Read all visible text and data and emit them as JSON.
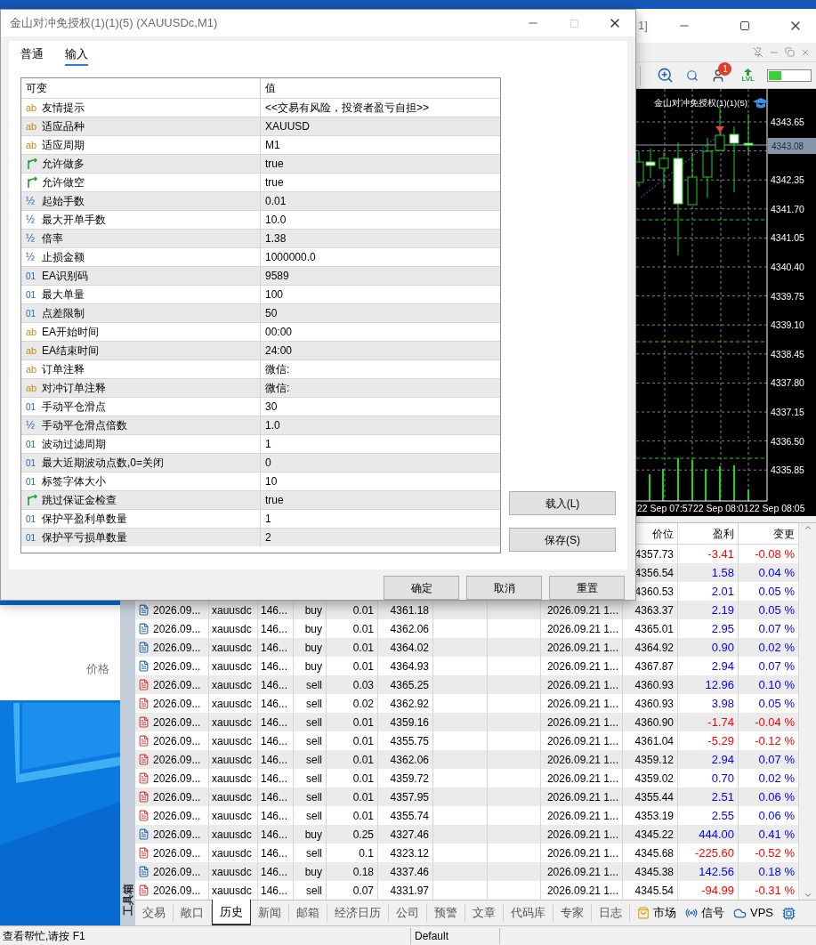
{
  "dialog": {
    "title": "金山对冲免授权(1)(1)(5) (XAUUSDc,M1)",
    "tabs": [
      {
        "label": "普通",
        "selected": false
      },
      {
        "label": "输入",
        "selected": true
      }
    ],
    "columns": [
      "可变",
      "值"
    ],
    "params": [
      {
        "kind": "string",
        "icon": "ab",
        "name": "友情提示",
        "value": "<<交易有风险，投资者盈亏自担>>"
      },
      {
        "kind": "string",
        "icon": "ab",
        "name": "适应品种",
        "value": "XAUUSD"
      },
      {
        "kind": "string",
        "icon": "ab",
        "name": "适应周期",
        "value": "M1"
      },
      {
        "kind": "bool",
        "name": "允许做多",
        "value": "true"
      },
      {
        "kind": "bool",
        "name": "允许做空",
        "value": "true"
      },
      {
        "kind": "double",
        "icon": "½",
        "name": "起始手数",
        "value": "0.01"
      },
      {
        "kind": "double",
        "icon": "½",
        "name": "最大开单手数",
        "value": "10.0"
      },
      {
        "kind": "double",
        "icon": "½",
        "name": "倍率",
        "value": "1.38"
      },
      {
        "kind": "double",
        "icon": "½",
        "name": "止损金额",
        "value": "1000000.0"
      },
      {
        "kind": "int",
        "icon": "01",
        "name": "EA识别码",
        "value": "9589"
      },
      {
        "kind": "int",
        "icon": "01",
        "name": "最大单量",
        "value": "100"
      },
      {
        "kind": "int",
        "icon": "01",
        "name": "点差限制",
        "value": "50"
      },
      {
        "kind": "string",
        "icon": "ab",
        "name": "EA开始时间",
        "value": "00:00"
      },
      {
        "kind": "string",
        "icon": "ab",
        "name": "EA结束时间",
        "value": "24:00"
      },
      {
        "kind": "string",
        "icon": "ab",
        "name": "订单注释",
        "value": "微信:"
      },
      {
        "kind": "string",
        "icon": "ab",
        "name": "对冲订单注释",
        "value": "微信:"
      },
      {
        "kind": "int",
        "icon": "01",
        "name": "手动平仓滑点",
        "value": "30"
      },
      {
        "kind": "double",
        "icon": "½",
        "name": "手动平仓滑点倍数",
        "value": "1.0"
      },
      {
        "kind": "int",
        "icon": "01",
        "name": "波动过滤周期",
        "value": "1"
      },
      {
        "kind": "int",
        "icon": "01",
        "name": "最大近期波动点数,0=关闭",
        "value": "0"
      },
      {
        "kind": "int",
        "icon": "01",
        "name": "标签字体大小",
        "value": "10"
      },
      {
        "kind": "bool",
        "name": "跳过保证金检查",
        "value": "true"
      },
      {
        "kind": "int",
        "icon": "01",
        "name": "保护平盈利单数量",
        "value": "1"
      },
      {
        "kind": "int",
        "icon": "01",
        "name": "保护平亏损单数量",
        "value": "2"
      }
    ],
    "side_buttons": [
      "载入(L)",
      "保存(S)"
    ],
    "buttons": [
      "确定",
      "取消",
      "重置"
    ]
  },
  "background_window": {
    "column": "价格"
  },
  "main_window": {
    "title": "1]",
    "toolbar": {
      "notification_count": "1",
      "lvl_label": "LVL",
      "level": 0.3
    },
    "chart": {
      "title": "金山对冲免授权(1)(1)(5)",
      "price_labels": [
        "4343.65",
        "4342.35",
        "4341.70",
        "4341.05",
        "4340.40",
        "4339.75",
        "4339.10",
        "4338.45",
        "4337.80",
        "4337.15",
        "4336.50",
        "4335.85"
      ],
      "current_price": "4343.08",
      "time_labels": [
        "22 Sep 07:57",
        "22 Sep 08:01",
        "22 Sep 08:05"
      ]
    },
    "table": {
      "columns": [
        "价位",
        "盈利",
        "变更"
      ],
      "rows": [
        {
          "close_price": "4357.73",
          "profit": "-3.41",
          "change": "-0.08 %",
          "color": "#ff0000"
        },
        {
          "close_price": "4356.54",
          "profit": "1.58",
          "change": "0.04 %",
          "color": "#0000ff"
        },
        {
          "close_price": "4360.53",
          "profit": "2.01",
          "change": "0.05 %",
          "color": "#0000ff"
        },
        {
          "kind": "buy",
          "time": "2026.09...",
          "symbol": "xauusdc",
          "ticket": "146...",
          "type": "buy",
          "size": "0.01",
          "price": "4361.18",
          "close_time": "2026.09.21 1...",
          "close_price": "4363.37",
          "profit": "2.19",
          "change": "0.05 %",
          "color": "#0000ff"
        },
        {
          "kind": "buy",
          "time": "2026.09...",
          "symbol": "xauusdc",
          "ticket": "146...",
          "type": "buy",
          "size": "0.01",
          "price": "4362.06",
          "close_time": "2026.09.21 1...",
          "close_price": "4365.01",
          "profit": "2.95",
          "change": "0.07 %",
          "color": "#0000ff"
        },
        {
          "kind": "buy",
          "time": "2026.09...",
          "symbol": "xauusdc",
          "ticket": "146...",
          "type": "buy",
          "size": "0.01",
          "price": "4364.02",
          "close_time": "2026.09.21 1...",
          "close_price": "4364.92",
          "profit": "0.90",
          "change": "0.02 %",
          "color": "#0000ff"
        },
        {
          "kind": "buy",
          "time": "2026.09...",
          "symbol": "xauusdc",
          "ticket": "146...",
          "type": "buy",
          "size": "0.01",
          "price": "4364.93",
          "close_time": "2026.09.21 1...",
          "close_price": "4367.87",
          "profit": "2.94",
          "change": "0.07 %",
          "color": "#0000ff"
        },
        {
          "kind": "sell",
          "time": "2026.09...",
          "symbol": "xauusdc",
          "ticket": "146...",
          "type": "sell",
          "size": "0.03",
          "price": "4365.25",
          "close_time": "2026.09.21 1...",
          "close_price": "4360.93",
          "profit": "12.96",
          "change": "0.10 %",
          "color": "#0000ff"
        },
        {
          "kind": "sell",
          "time": "2026.09...",
          "symbol": "xauusdc",
          "ticket": "146...",
          "type": "sell",
          "size": "0.02",
          "price": "4362.92",
          "close_time": "2026.09.21 1...",
          "close_price": "4360.93",
          "profit": "3.98",
          "change": "0.05 %",
          "color": "#0000ff"
        },
        {
          "kind": "sell",
          "time": "2026.09...",
          "symbol": "xauusdc",
          "ticket": "146...",
          "type": "sell",
          "size": "0.01",
          "price": "4359.16",
          "close_time": "2026.09.21 1...",
          "close_price": "4360.90",
          "profit": "-1.74",
          "change": "-0.04 %",
          "color": "#ff0000"
        },
        {
          "kind": "sell",
          "time": "2026.09...",
          "symbol": "xauusdc",
          "ticket": "146...",
          "type": "sell",
          "size": "0.01",
          "price": "4355.75",
          "close_time": "2026.09.21 1...",
          "close_price": "4361.04",
          "profit": "-5.29",
          "change": "-0.12 %",
          "color": "#ff0000"
        },
        {
          "kind": "sell",
          "time": "2026.09...",
          "symbol": "xauusdc",
          "ticket": "146...",
          "type": "sell",
          "size": "0.01",
          "price": "4362.06",
          "close_time": "2026.09.21 1...",
          "close_price": "4359.12",
          "profit": "2.94",
          "change": "0.07 %",
          "color": "#0000ff"
        },
        {
          "kind": "sell",
          "time": "2026.09...",
          "symbol": "xauusdc",
          "ticket": "146...",
          "type": "sell",
          "size": "0.01",
          "price": "4359.72",
          "close_time": "2026.09.21 1...",
          "close_price": "4359.02",
          "profit": "0.70",
          "change": "0.02 %",
          "color": "#0000ff"
        },
        {
          "kind": "sell",
          "time": "2026.09...",
          "symbol": "xauusdc",
          "ticket": "146...",
          "type": "sell",
          "size": "0.01",
          "price": "4357.95",
          "close_time": "2026.09.21 1...",
          "close_price": "4355.44",
          "profit": "2.51",
          "change": "0.06 %",
          "color": "#0000ff"
        },
        {
          "kind": "sell",
          "time": "2026.09...",
          "symbol": "xauusdc",
          "ticket": "146...",
          "type": "sell",
          "size": "0.01",
          "price": "4355.74",
          "close_time": "2026.09.21 1...",
          "close_price": "4353.19",
          "profit": "2.55",
          "change": "0.06 %",
          "color": "#0000ff"
        },
        {
          "kind": "buy",
          "time": "2026.09...",
          "symbol": "xauusdc",
          "ticket": "146...",
          "type": "buy",
          "size": "0.25",
          "price": "4327.46",
          "close_time": "2026.09.21 1...",
          "close_price": "4345.22",
          "profit": "444.00",
          "change": "0.41 %",
          "color": "#0000ff"
        },
        {
          "kind": "sell",
          "time": "2026.09...",
          "symbol": "xauusdc",
          "ticket": "146...",
          "type": "sell",
          "size": "0.1",
          "price": "4323.12",
          "close_time": "2026.09.21 1...",
          "close_price": "4345.68",
          "profit": "-225.60",
          "change": "-0.52 %",
          "color": "#ff0000"
        },
        {
          "kind": "buy",
          "time": "2026.09...",
          "symbol": "xauusdc",
          "ticket": "146...",
          "type": "buy",
          "size": "0.18",
          "price": "4337.46",
          "close_time": "2026.09.21 1...",
          "close_price": "4345.38",
          "profit": "142.56",
          "change": "0.18 %",
          "color": "#0000ff"
        },
        {
          "kind": "sell",
          "time": "2026.09...",
          "symbol": "xauusdc",
          "ticket": "146...",
          "type": "sell",
          "size": "0.07",
          "price": "4331.97",
          "close_time": "2026.09.21 1...",
          "close_price": "4345.54",
          "profit": "-94.99",
          "change": "-0.31 %",
          "color": "#ff0000"
        }
      ]
    },
    "toolbox_label": "工具箱",
    "tabs": [
      {
        "label": "交易",
        "selected": false
      },
      {
        "label": "敞口",
        "selected": false
      },
      {
        "label": "历史",
        "selected": true
      },
      {
        "label": "新闻",
        "selected": false
      },
      {
        "label": "邮箱",
        "selected": false
      },
      {
        "label": "经济日历",
        "selected": false
      },
      {
        "label": "公司",
        "selected": false
      },
      {
        "label": "预警",
        "selected": false
      },
      {
        "label": "文章",
        "selected": false
      },
      {
        "label": "代码库",
        "selected": false
      },
      {
        "label": "专家",
        "selected": false
      },
      {
        "label": "日志",
        "selected": false
      }
    ],
    "services": [
      {
        "kind": "market",
        "label": "市场"
      },
      {
        "kind": "signal",
        "label": "信号"
      },
      {
        "kind": "vps",
        "label": "VPS"
      },
      {
        "kind": "hosting"
      }
    ],
    "status_bar": [
      "查看帮忙,请按 F1",
      "Default"
    ]
  }
}
